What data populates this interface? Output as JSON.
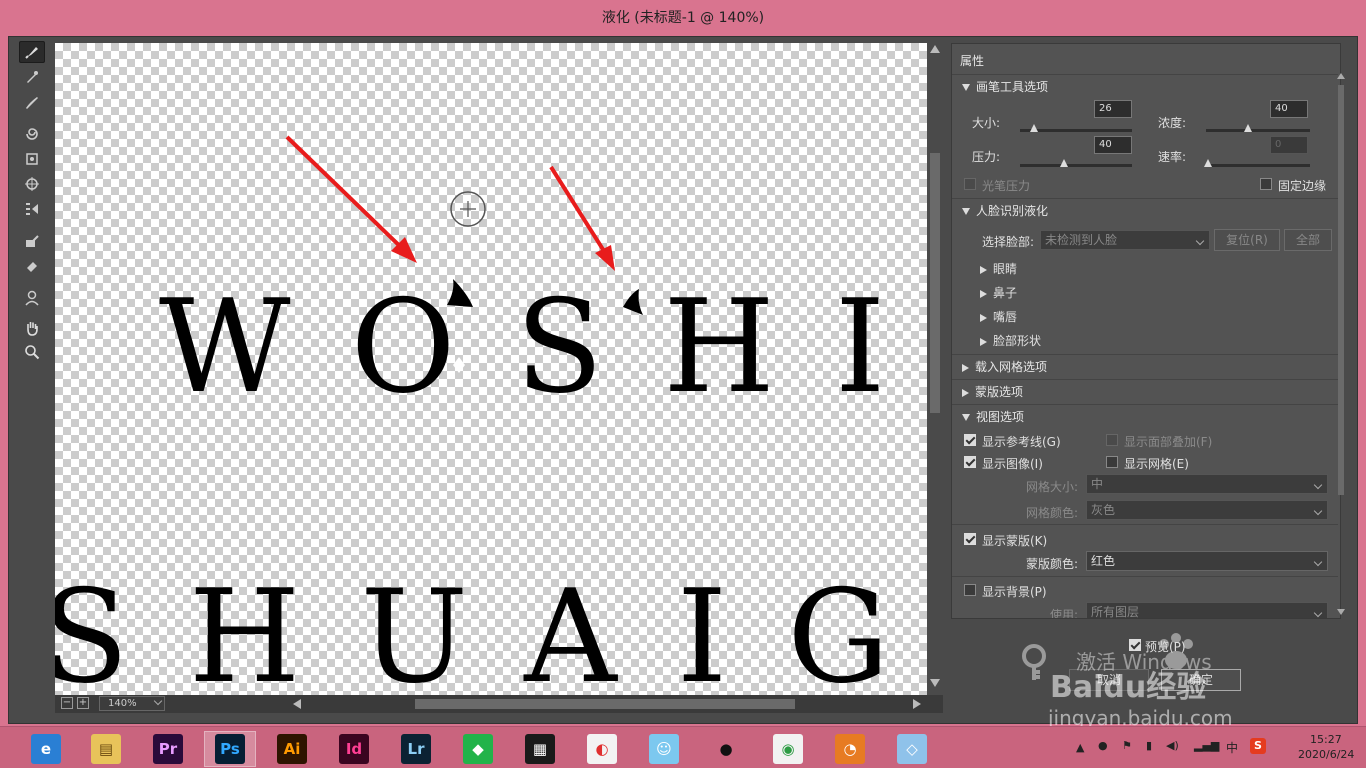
{
  "window": {
    "title": "液化 (未标题-1 @ 140%)"
  },
  "canvas": {
    "line1": "WOSHI",
    "line2": "SHUAIG",
    "zoom": "140%",
    "arrow_color": "#e81c1c"
  },
  "panel": {
    "header": "属性",
    "brush_section": {
      "title": "画笔工具选项",
      "size_label": "大小:",
      "size_value": "26",
      "density_label": "浓度:",
      "density_value": "40",
      "pressure_label": "压力:",
      "pressure_value": "40",
      "rate_label": "速率:",
      "rate_value": "0",
      "stylus_label": "光笔压力",
      "pin_edges_label": "固定边缘"
    },
    "face_section": {
      "title": "人脸识别液化",
      "select_face_label": "选择脸部:",
      "select_face_value": "未检测到人脸",
      "reset_label": "复位(R)",
      "all_label": "全部",
      "items": [
        "眼睛",
        "鼻子",
        "嘴唇",
        "脸部形状"
      ]
    },
    "load_mesh_title": "载入网格选项",
    "mask_options_title": "蒙版选项",
    "view_section": {
      "title": "视图选项",
      "show_guides": "显示参考线(G)",
      "show_face_overlay": "显示面部叠加(F)",
      "show_image": "显示图像(I)",
      "show_mesh": "显示网格(E)",
      "mesh_size_label": "网格大小:",
      "mesh_size_value": "中",
      "mesh_color_label": "网格颜色:",
      "mesh_color_value": "灰色"
    },
    "show_mask": "显示蒙版(K)",
    "mask_color_label": "蒙版颜色:",
    "mask_color_value": "红色",
    "show_backdrop": "显示背景(P)",
    "use_label": "使用:",
    "use_value": "所有图层"
  },
  "bottom": {
    "preview_label": "预览(P)",
    "cancel_label": "取消",
    "ok_label": "确定"
  },
  "watermark": {
    "brand": "Baidu经验",
    "url": "jingyan.baidu.com",
    "activate_text": "激活 Windows"
  },
  "taskbar": {
    "apps": [
      {
        "name": "browser-360",
        "label": "e",
        "bg": "#2a7fd4",
        "fg": "#ffffff"
      },
      {
        "name": "file-explorer",
        "label": "▤",
        "bg": "#e8c35a",
        "fg": "#6a4a10"
      },
      {
        "name": "premiere",
        "label": "Pr",
        "bg": "#2a0a3a",
        "fg": "#e89cff"
      },
      {
        "name": "photoshop",
        "label": "Ps",
        "bg": "#061e33",
        "fg": "#31a8ff"
      },
      {
        "name": "illustrator",
        "label": "Ai",
        "bg": "#2e1400",
        "fg": "#ff9a00"
      },
      {
        "name": "indesign",
        "label": "Id",
        "bg": "#3a0520",
        "fg": "#ff3f94"
      },
      {
        "name": "lightroom",
        "label": "Lr",
        "bg": "#0b2233",
        "fg": "#8ccff5"
      },
      {
        "name": "cloud-app",
        "label": "◆",
        "bg": "#22b34a",
        "fg": "#ffffff"
      },
      {
        "name": "video-app",
        "label": "▦",
        "bg": "#1a1a1a",
        "fg": "#ffffff"
      },
      {
        "name": "game-app",
        "label": "◐",
        "bg": "#f3f3f3",
        "fg": "#e03030"
      },
      {
        "name": "chat-app",
        "label": "☺",
        "bg": "#7cc8ef",
        "fg": "#ffffff"
      },
      {
        "name": "qq",
        "label": "●",
        "bg": "#c9647e",
        "fg": "#111111"
      },
      {
        "name": "chrome",
        "label": "◉",
        "bg": "#f2f2f2",
        "fg": "#2d9c44"
      },
      {
        "name": "media-app",
        "label": "◔",
        "bg": "#e77b22",
        "fg": "#ffffff"
      },
      {
        "name": "notes-app",
        "label": "◇",
        "bg": "#8fc2ea",
        "fg": "#ffffff"
      }
    ],
    "ime": "中",
    "time": "15:27",
    "date": "2020/6/24"
  }
}
